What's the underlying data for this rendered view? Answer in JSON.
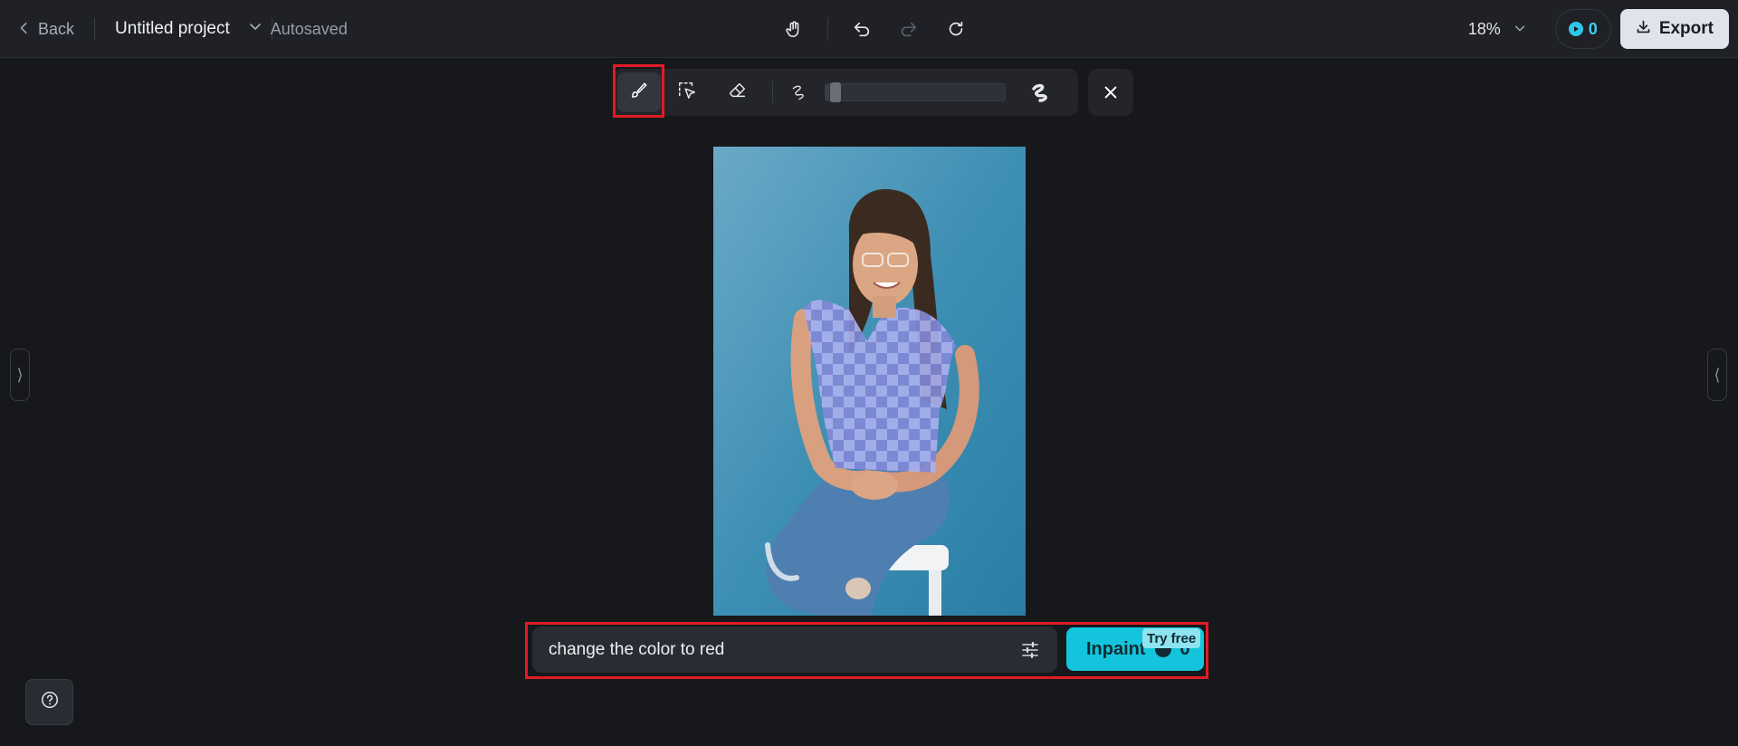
{
  "header": {
    "back_label": "Back",
    "project_title": "Untitled project",
    "save_status": "Autosaved",
    "zoom": "18%",
    "credits": "0",
    "export_label": "Export"
  },
  "tools": {
    "active": "brush",
    "brush_size_level": 0.02
  },
  "prompt": {
    "value": "change the color to red",
    "inpaint_label": "Inpaint",
    "inpaint_cost": "0",
    "badge": "Try free"
  },
  "icons": {
    "back": "chevron-left-icon",
    "title_menu": "chevron-down-icon",
    "pan": "hand-icon",
    "undo": "undo-icon",
    "redo": "redo-icon",
    "refresh": "refresh-icon",
    "zoom_menu": "chevron-down-icon",
    "credits": "credit-icon",
    "export": "download-icon",
    "brush": "brush-icon",
    "smart_select": "smart-select-icon",
    "eraser": "eraser-icon",
    "size_small": "brush-small-icon",
    "size_large": "brush-large-icon",
    "close": "close-icon",
    "settings": "sliders-icon",
    "help": "help-icon"
  },
  "colors": {
    "accent": "#14c4dc",
    "highlight": "#e01b24",
    "mask": "#8c8cff"
  }
}
